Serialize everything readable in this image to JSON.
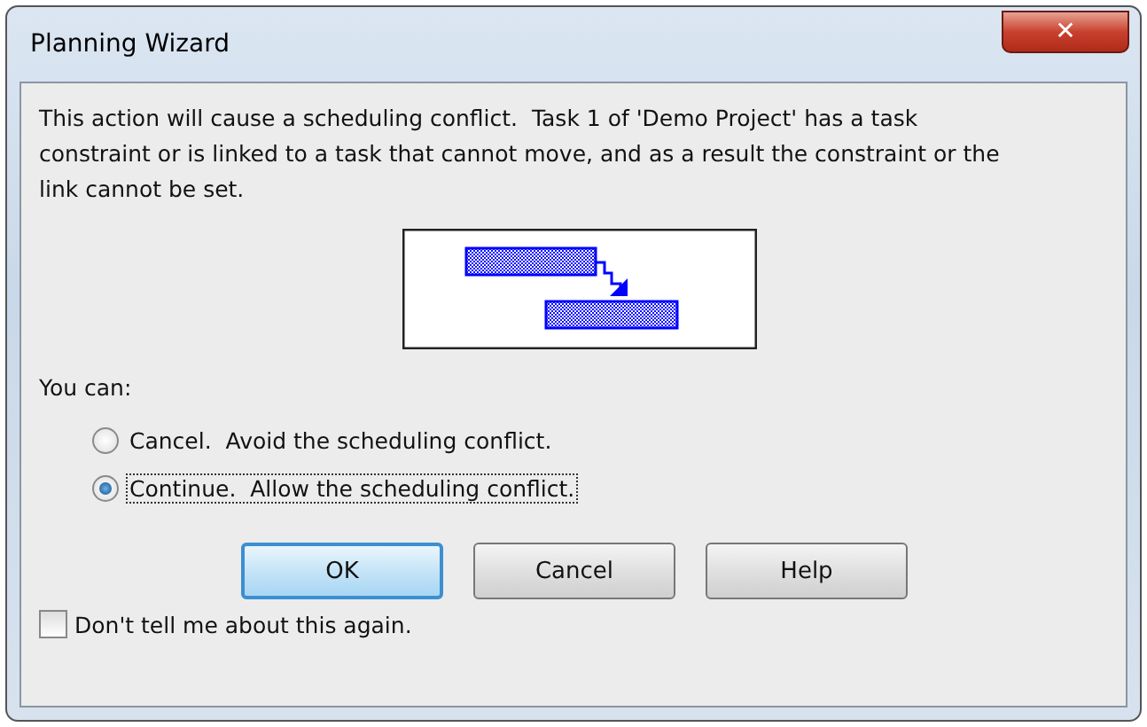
{
  "window": {
    "title": "Planning Wizard",
    "close": "✕"
  },
  "message": "This action will cause a scheduling conflict.  Task 1 of 'Demo Project' has a task constraint or is linked to a task that cannot move, and as a result the constraint or the link cannot be set.",
  "prompt": "You can:",
  "options": [
    {
      "label": "Cancel.  Avoid the scheduling conflict.",
      "selected": false,
      "focused": false
    },
    {
      "label": "Continue.  Allow the scheduling conflict.",
      "selected": true,
      "focused": true
    }
  ],
  "buttons": [
    {
      "label": "OK",
      "default": true
    },
    {
      "label": "Cancel",
      "default": false
    },
    {
      "label": "Help",
      "default": false
    }
  ],
  "dont_show_again": {
    "label": "Don't tell me about this again.",
    "checked": false
  }
}
